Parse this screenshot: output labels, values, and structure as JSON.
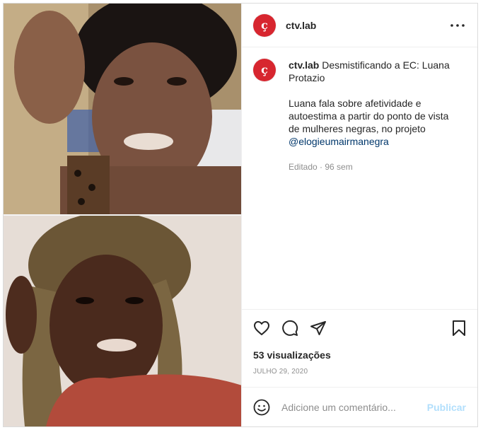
{
  "account": {
    "username": "ctv.lab",
    "avatar_glyph": "ç",
    "avatar_color": "#d7262f"
  },
  "header": {
    "more_icon": "more-horizontal-icon"
  },
  "caption": {
    "username": "ctv.lab",
    "title": "Desmistificando a EC: Luana Protazio",
    "body": "Luana fala sobre afetividade e autoestima a partir do ponto de vista de mulheres negras, no projeto",
    "mention": "@elogieumairmanegra",
    "meta": "Editado · 96 sem"
  },
  "actions": {
    "icons": [
      "heart-icon",
      "comment-icon",
      "share-icon",
      "bookmark-icon"
    ],
    "views": "53 visualizações",
    "date": "JULHO 29, 2020"
  },
  "comment": {
    "placeholder": "Adicione um comentário...",
    "post_label": "Publicar",
    "emoji_icon": "emoji-icon"
  },
  "colors": {
    "link": "#00376b",
    "muted": "#8e8e8e",
    "post_disabled": "#b2dffc"
  }
}
